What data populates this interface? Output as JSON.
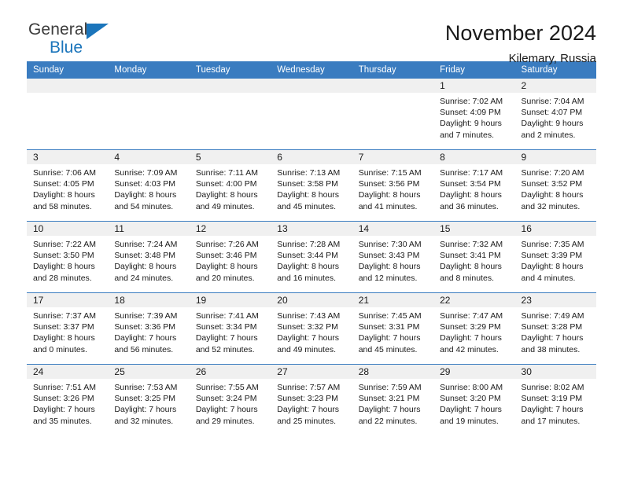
{
  "brand": {
    "name_part1": "General",
    "name_part2": "Blue",
    "triangle_color": "#1b75bb"
  },
  "header": {
    "title": "November 2024",
    "subtitle": "Kilemary, Russia"
  },
  "theme": {
    "header_blue": "#3a7cc0",
    "day_strip_gray": "#f0f0f0",
    "text_color": "#1a1a1a"
  },
  "weekdays": [
    "Sunday",
    "Monday",
    "Tuesday",
    "Wednesday",
    "Thursday",
    "Friday",
    "Saturday"
  ],
  "weeks": [
    [
      {
        "day": "",
        "empty": true
      },
      {
        "day": "",
        "empty": true
      },
      {
        "day": "",
        "empty": true
      },
      {
        "day": "",
        "empty": true
      },
      {
        "day": "",
        "empty": true
      },
      {
        "day": "1",
        "sunrise": "Sunrise: 7:02 AM",
        "sunset": "Sunset: 4:09 PM",
        "daylight1": "Daylight: 9 hours",
        "daylight2": "and 7 minutes."
      },
      {
        "day": "2",
        "sunrise": "Sunrise: 7:04 AM",
        "sunset": "Sunset: 4:07 PM",
        "daylight1": "Daylight: 9 hours",
        "daylight2": "and 2 minutes."
      }
    ],
    [
      {
        "day": "3",
        "sunrise": "Sunrise: 7:06 AM",
        "sunset": "Sunset: 4:05 PM",
        "daylight1": "Daylight: 8 hours",
        "daylight2": "and 58 minutes."
      },
      {
        "day": "4",
        "sunrise": "Sunrise: 7:09 AM",
        "sunset": "Sunset: 4:03 PM",
        "daylight1": "Daylight: 8 hours",
        "daylight2": "and 54 minutes."
      },
      {
        "day": "5",
        "sunrise": "Sunrise: 7:11 AM",
        "sunset": "Sunset: 4:00 PM",
        "daylight1": "Daylight: 8 hours",
        "daylight2": "and 49 minutes."
      },
      {
        "day": "6",
        "sunrise": "Sunrise: 7:13 AM",
        "sunset": "Sunset: 3:58 PM",
        "daylight1": "Daylight: 8 hours",
        "daylight2": "and 45 minutes."
      },
      {
        "day": "7",
        "sunrise": "Sunrise: 7:15 AM",
        "sunset": "Sunset: 3:56 PM",
        "daylight1": "Daylight: 8 hours",
        "daylight2": "and 41 minutes."
      },
      {
        "day": "8",
        "sunrise": "Sunrise: 7:17 AM",
        "sunset": "Sunset: 3:54 PM",
        "daylight1": "Daylight: 8 hours",
        "daylight2": "and 36 minutes."
      },
      {
        "day": "9",
        "sunrise": "Sunrise: 7:20 AM",
        "sunset": "Sunset: 3:52 PM",
        "daylight1": "Daylight: 8 hours",
        "daylight2": "and 32 minutes."
      }
    ],
    [
      {
        "day": "10",
        "sunrise": "Sunrise: 7:22 AM",
        "sunset": "Sunset: 3:50 PM",
        "daylight1": "Daylight: 8 hours",
        "daylight2": "and 28 minutes."
      },
      {
        "day": "11",
        "sunrise": "Sunrise: 7:24 AM",
        "sunset": "Sunset: 3:48 PM",
        "daylight1": "Daylight: 8 hours",
        "daylight2": "and 24 minutes."
      },
      {
        "day": "12",
        "sunrise": "Sunrise: 7:26 AM",
        "sunset": "Sunset: 3:46 PM",
        "daylight1": "Daylight: 8 hours",
        "daylight2": "and 20 minutes."
      },
      {
        "day": "13",
        "sunrise": "Sunrise: 7:28 AM",
        "sunset": "Sunset: 3:44 PM",
        "daylight1": "Daylight: 8 hours",
        "daylight2": "and 16 minutes."
      },
      {
        "day": "14",
        "sunrise": "Sunrise: 7:30 AM",
        "sunset": "Sunset: 3:43 PM",
        "daylight1": "Daylight: 8 hours",
        "daylight2": "and 12 minutes."
      },
      {
        "day": "15",
        "sunrise": "Sunrise: 7:32 AM",
        "sunset": "Sunset: 3:41 PM",
        "daylight1": "Daylight: 8 hours",
        "daylight2": "and 8 minutes."
      },
      {
        "day": "16",
        "sunrise": "Sunrise: 7:35 AM",
        "sunset": "Sunset: 3:39 PM",
        "daylight1": "Daylight: 8 hours",
        "daylight2": "and 4 minutes."
      }
    ],
    [
      {
        "day": "17",
        "sunrise": "Sunrise: 7:37 AM",
        "sunset": "Sunset: 3:37 PM",
        "daylight1": "Daylight: 8 hours",
        "daylight2": "and 0 minutes."
      },
      {
        "day": "18",
        "sunrise": "Sunrise: 7:39 AM",
        "sunset": "Sunset: 3:36 PM",
        "daylight1": "Daylight: 7 hours",
        "daylight2": "and 56 minutes."
      },
      {
        "day": "19",
        "sunrise": "Sunrise: 7:41 AM",
        "sunset": "Sunset: 3:34 PM",
        "daylight1": "Daylight: 7 hours",
        "daylight2": "and 52 minutes."
      },
      {
        "day": "20",
        "sunrise": "Sunrise: 7:43 AM",
        "sunset": "Sunset: 3:32 PM",
        "daylight1": "Daylight: 7 hours",
        "daylight2": "and 49 minutes."
      },
      {
        "day": "21",
        "sunrise": "Sunrise: 7:45 AM",
        "sunset": "Sunset: 3:31 PM",
        "daylight1": "Daylight: 7 hours",
        "daylight2": "and 45 minutes."
      },
      {
        "day": "22",
        "sunrise": "Sunrise: 7:47 AM",
        "sunset": "Sunset: 3:29 PM",
        "daylight1": "Daylight: 7 hours",
        "daylight2": "and 42 minutes."
      },
      {
        "day": "23",
        "sunrise": "Sunrise: 7:49 AM",
        "sunset": "Sunset: 3:28 PM",
        "daylight1": "Daylight: 7 hours",
        "daylight2": "and 38 minutes."
      }
    ],
    [
      {
        "day": "24",
        "sunrise": "Sunrise: 7:51 AM",
        "sunset": "Sunset: 3:26 PM",
        "daylight1": "Daylight: 7 hours",
        "daylight2": "and 35 minutes."
      },
      {
        "day": "25",
        "sunrise": "Sunrise: 7:53 AM",
        "sunset": "Sunset: 3:25 PM",
        "daylight1": "Daylight: 7 hours",
        "daylight2": "and 32 minutes."
      },
      {
        "day": "26",
        "sunrise": "Sunrise: 7:55 AM",
        "sunset": "Sunset: 3:24 PM",
        "daylight1": "Daylight: 7 hours",
        "daylight2": "and 29 minutes."
      },
      {
        "day": "27",
        "sunrise": "Sunrise: 7:57 AM",
        "sunset": "Sunset: 3:23 PM",
        "daylight1": "Daylight: 7 hours",
        "daylight2": "and 25 minutes."
      },
      {
        "day": "28",
        "sunrise": "Sunrise: 7:59 AM",
        "sunset": "Sunset: 3:21 PM",
        "daylight1": "Daylight: 7 hours",
        "daylight2": "and 22 minutes."
      },
      {
        "day": "29",
        "sunrise": "Sunrise: 8:00 AM",
        "sunset": "Sunset: 3:20 PM",
        "daylight1": "Daylight: 7 hours",
        "daylight2": "and 19 minutes."
      },
      {
        "day": "30",
        "sunrise": "Sunrise: 8:02 AM",
        "sunset": "Sunset: 3:19 PM",
        "daylight1": "Daylight: 7 hours",
        "daylight2": "and 17 minutes."
      }
    ]
  ]
}
